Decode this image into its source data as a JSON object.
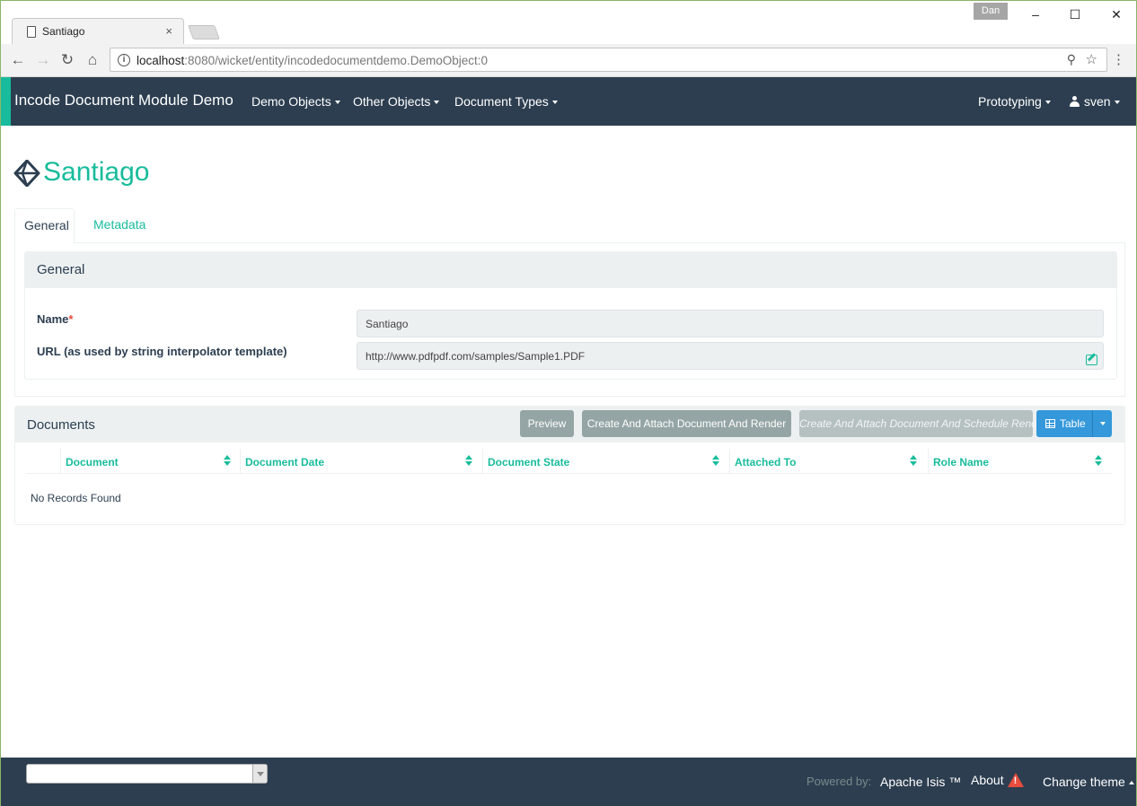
{
  "browser": {
    "tab_title": "Santiago",
    "tab_close": "×",
    "profile_name": "Dan",
    "url_host": "localhost",
    "url_rest": ":8080/wicket/entity/incodedocumentdemo.DemoObject:0",
    "window_controls": {
      "minimize": "–",
      "maximize": "☐",
      "close": "✕"
    },
    "nav": {
      "back": "←",
      "forward": "→",
      "reload": "↻",
      "home": "⌂"
    },
    "icons": {
      "info": "info-icon",
      "zoom": "zoom-icon",
      "star": "star-icon",
      "menu": "menu-icon"
    }
  },
  "navbar": {
    "brand": "Incode Document Module Demo",
    "menus": [
      "Demo Objects",
      "Other Objects",
      "Document Types"
    ],
    "right_menus": {
      "prototyping": "Prototyping",
      "user": "sven"
    },
    "accent_color": "#18bc9c",
    "background": "#2c3e50"
  },
  "page": {
    "title": "Santiago",
    "tabs": [
      "General",
      "Metadata"
    ]
  },
  "general_panel": {
    "heading": "General",
    "fields": [
      {
        "label": "Name",
        "required": true,
        "value": "Santiago"
      },
      {
        "label": "URL (as used by string interpolator template)",
        "required": false,
        "value": "http://www.pdfpdf.com/samples/Sample1.PDF"
      }
    ]
  },
  "documents": {
    "heading": "Documents",
    "buttons": {
      "preview": "Preview",
      "create_render": "Create And Attach Document And Render",
      "create_schedule": "Create And Attach Document And Schedule Render",
      "table": "Table"
    },
    "columns": [
      "Document",
      "Document Date",
      "Document State",
      "Attached To",
      "Role Name"
    ],
    "empty_message": "No Records Found"
  },
  "footer": {
    "powered_by": "Powered by:",
    "apache_isis": "Apache Isis ™",
    "about": "About",
    "change_theme": "Change theme",
    "theme_select_value": ""
  }
}
